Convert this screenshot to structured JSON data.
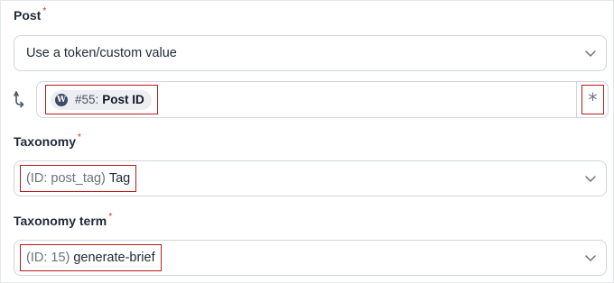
{
  "post": {
    "label": "Post",
    "required_mark": "*",
    "selected": "Use a token/custom value"
  },
  "token": {
    "number": "#55:",
    "name": "Post ID",
    "badge_letter": "W",
    "asterisk": "*"
  },
  "taxonomy": {
    "label": "Taxonomy",
    "required_mark": "*",
    "id_text": "(ID: post_tag)",
    "value": "Tag"
  },
  "taxonomy_term": {
    "label": "Taxonomy term",
    "required_mark": "*",
    "id_text": "(ID: 15)",
    "value": "generate-brief"
  },
  "icons": {
    "chevron": "chevron-down-icon",
    "token_arrow": "token-arrow-icon",
    "wordpress": "wordpress-icon",
    "asterisk": "asterisk-icon"
  },
  "colors": {
    "highlight_border": "#b91c1c",
    "required": "#dc2626",
    "border": "#d1d5db"
  }
}
